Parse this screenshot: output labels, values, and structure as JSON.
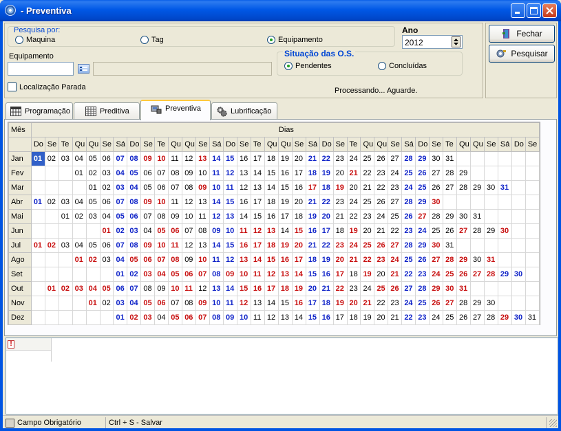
{
  "window": {
    "title": "- Preventiva"
  },
  "search": {
    "group_label": "Pesquisa por:",
    "options": [
      "Maquina",
      "Tag",
      "Equipamento"
    ],
    "selected": "Equipamento"
  },
  "year": {
    "label": "Ano",
    "value": "2012"
  },
  "buttons": {
    "close": "Fechar",
    "search": "Pesquisar"
  },
  "equipment": {
    "label": "Equipamento",
    "code": "",
    "description": ""
  },
  "situation": {
    "label": "Situação das O.S.",
    "options": [
      "Pendentes",
      "Concluídas"
    ],
    "selected": "Pendentes"
  },
  "location_stopped": {
    "label": "Localização Parada",
    "checked": false
  },
  "processing_text": "Processando... Aguarde.",
  "tabs": [
    {
      "label": "Programação",
      "icon": "calendar-grid-icon"
    },
    {
      "label": "Preditiva",
      "icon": "table-icon"
    },
    {
      "label": "Preventiva",
      "icon": "machine-icon",
      "active": true
    },
    {
      "label": "Lubrificação",
      "icon": "gears-icon"
    }
  ],
  "calendar": {
    "month_header": "Mês",
    "days_header": "Dias",
    "weekdays": [
      "Do",
      "Se",
      "Te",
      "Qu",
      "Qu",
      "Se",
      "Sá",
      "Do",
      "Se",
      "Te",
      "Qu",
      "Qu",
      "Se",
      "Sá",
      "Do",
      "Se",
      "Te",
      "Qu",
      "Qu",
      "Se",
      "Sá",
      "Do",
      "Se",
      "Te",
      "Qu",
      "Qu",
      "Se",
      "Sá",
      "Do",
      "Se",
      "Te",
      "Qu",
      "Qu",
      "Se",
      "Sá",
      "Do",
      "Se"
    ],
    "months": [
      {
        "name": "Jan",
        "offset": 0,
        "days": 31,
        "blue": [
          1,
          7,
          8,
          14,
          15,
          21,
          22,
          28,
          29
        ],
        "red": [
          9,
          10,
          13
        ],
        "selected": 1
      },
      {
        "name": "Fev",
        "offset": 3,
        "days": 29,
        "blue": [
          4,
          5,
          11,
          12,
          18,
          19,
          25,
          26
        ],
        "red": [
          21
        ]
      },
      {
        "name": "Mar",
        "offset": 4,
        "days": 31,
        "blue": [
          3,
          4,
          10,
          11,
          18,
          24,
          25,
          31
        ],
        "red": [
          9,
          17,
          19
        ]
      },
      {
        "name": "Abr",
        "offset": 0,
        "days": 30,
        "blue": [
          1,
          7,
          8,
          14,
          15,
          21,
          22,
          28,
          29
        ],
        "red": [
          9,
          10,
          30
        ]
      },
      {
        "name": "Mai",
        "offset": 2,
        "days": 31,
        "blue": [
          5,
          6,
          12,
          13,
          19,
          20,
          26
        ],
        "red": [
          27
        ]
      },
      {
        "name": "Jun",
        "offset": 5,
        "days": 30,
        "blue": [
          2,
          3,
          9,
          10,
          16,
          17,
          23,
          24
        ],
        "red": [
          1,
          5,
          6,
          11,
          12,
          13,
          15,
          19,
          27,
          30
        ]
      },
      {
        "name": "Jul",
        "offset": 0,
        "days": 31,
        "blue": [
          7,
          8,
          14,
          15,
          21,
          22,
          28,
          29
        ],
        "red": [
          1,
          2,
          9,
          10,
          11,
          16,
          17,
          18,
          19,
          20,
          23,
          24,
          25,
          26,
          27,
          30
        ]
      },
      {
        "name": "Ago",
        "offset": 3,
        "days": 31,
        "blue": [
          4,
          11,
          12,
          18,
          19,
          25,
          26
        ],
        "red": [
          1,
          2,
          5,
          6,
          7,
          8,
          10,
          13,
          14,
          15,
          16,
          17,
          20,
          21,
          22,
          23,
          24,
          27,
          28,
          29,
          31
        ]
      },
      {
        "name": "Set",
        "offset": 6,
        "days": 30,
        "blue": [
          1,
          2,
          8,
          15,
          16,
          22,
          23,
          29,
          30
        ],
        "red": [
          3,
          4,
          5,
          6,
          7,
          9,
          10,
          11,
          12,
          13,
          14,
          17,
          19,
          21,
          24,
          25,
          26,
          27,
          28
        ]
      },
      {
        "name": "Out",
        "offset": 1,
        "days": 31,
        "blue": [
          6,
          7,
          13,
          14,
          20,
          21,
          27,
          28
        ],
        "red": [
          1,
          2,
          3,
          4,
          5,
          10,
          11,
          15,
          16,
          17,
          18,
          19,
          22,
          25,
          26,
          29,
          30,
          31
        ]
      },
      {
        "name": "Nov",
        "offset": 4,
        "days": 30,
        "blue": [
          3,
          4,
          10,
          11,
          17,
          18,
          24,
          25
        ],
        "red": [
          1,
          5,
          6,
          9,
          12,
          16,
          19,
          20,
          21,
          26,
          27
        ]
      },
      {
        "name": "Dez",
        "offset": 6,
        "days": 31,
        "blue": [
          1,
          8,
          9,
          10,
          15,
          16,
          22,
          23,
          30
        ],
        "red": [
          2,
          3,
          5,
          6,
          7,
          29
        ]
      }
    ]
  },
  "statusbar": {
    "required_field": "Campo Obrigatório",
    "save_hint": "Ctrl + S - Salvar"
  }
}
